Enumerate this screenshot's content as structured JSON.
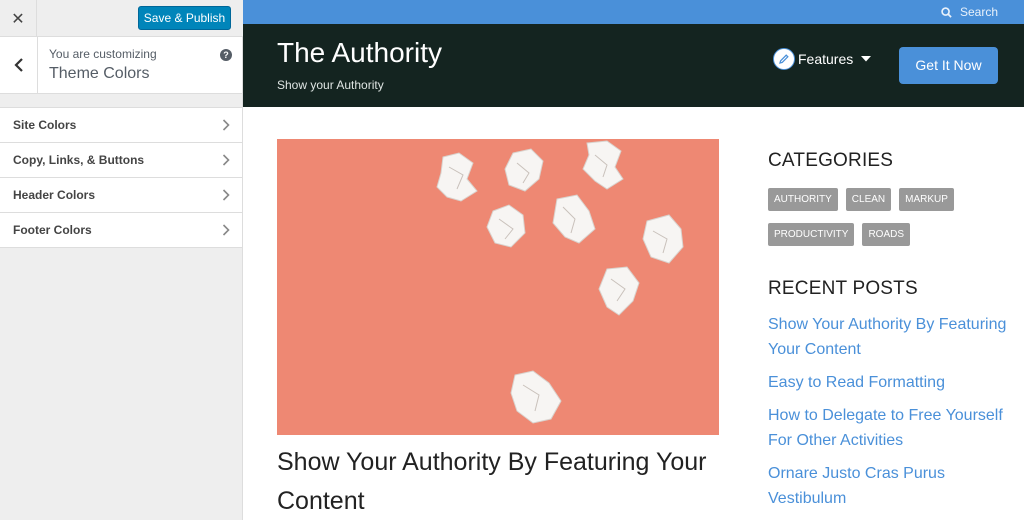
{
  "customizer": {
    "close_icon": "close-icon",
    "publish_label": "Save & Publish",
    "customizing_label": "You are customizing",
    "section_title": "Theme Colors",
    "help_symbol": "?",
    "menu": [
      {
        "label": "Site Colors"
      },
      {
        "label": "Copy, Links, & Buttons"
      },
      {
        "label": "Header Colors"
      },
      {
        "label": "Footer Colors"
      }
    ]
  },
  "preview": {
    "search_label": "Search",
    "site_title": "The Authority",
    "tagline": "Show your Authority",
    "nav_features": "Features",
    "cta_label": "Get It Now",
    "post_title": "Show Your Authority By Featuring Your Content",
    "sidebar": {
      "categories_title": "CATEGORIES",
      "tags": [
        "AUTHORITY",
        "CLEAN",
        "MARKUP",
        "PRODUCTIVITY",
        "ROADS"
      ],
      "recent_title": "RECENT POSTS",
      "recent_posts": [
        "Show Your Authority By Featuring Your Content",
        "Easy to Read Formatting",
        "How to Delegate to Free Yourself For Other Activities",
        "Ornare Justo Cras Purus Vestibulum"
      ]
    }
  },
  "colors": {
    "accent": "#4a90d9",
    "header_bg": "#142420",
    "publish_button": "#0085ba",
    "image_bg": "#ee8873"
  }
}
